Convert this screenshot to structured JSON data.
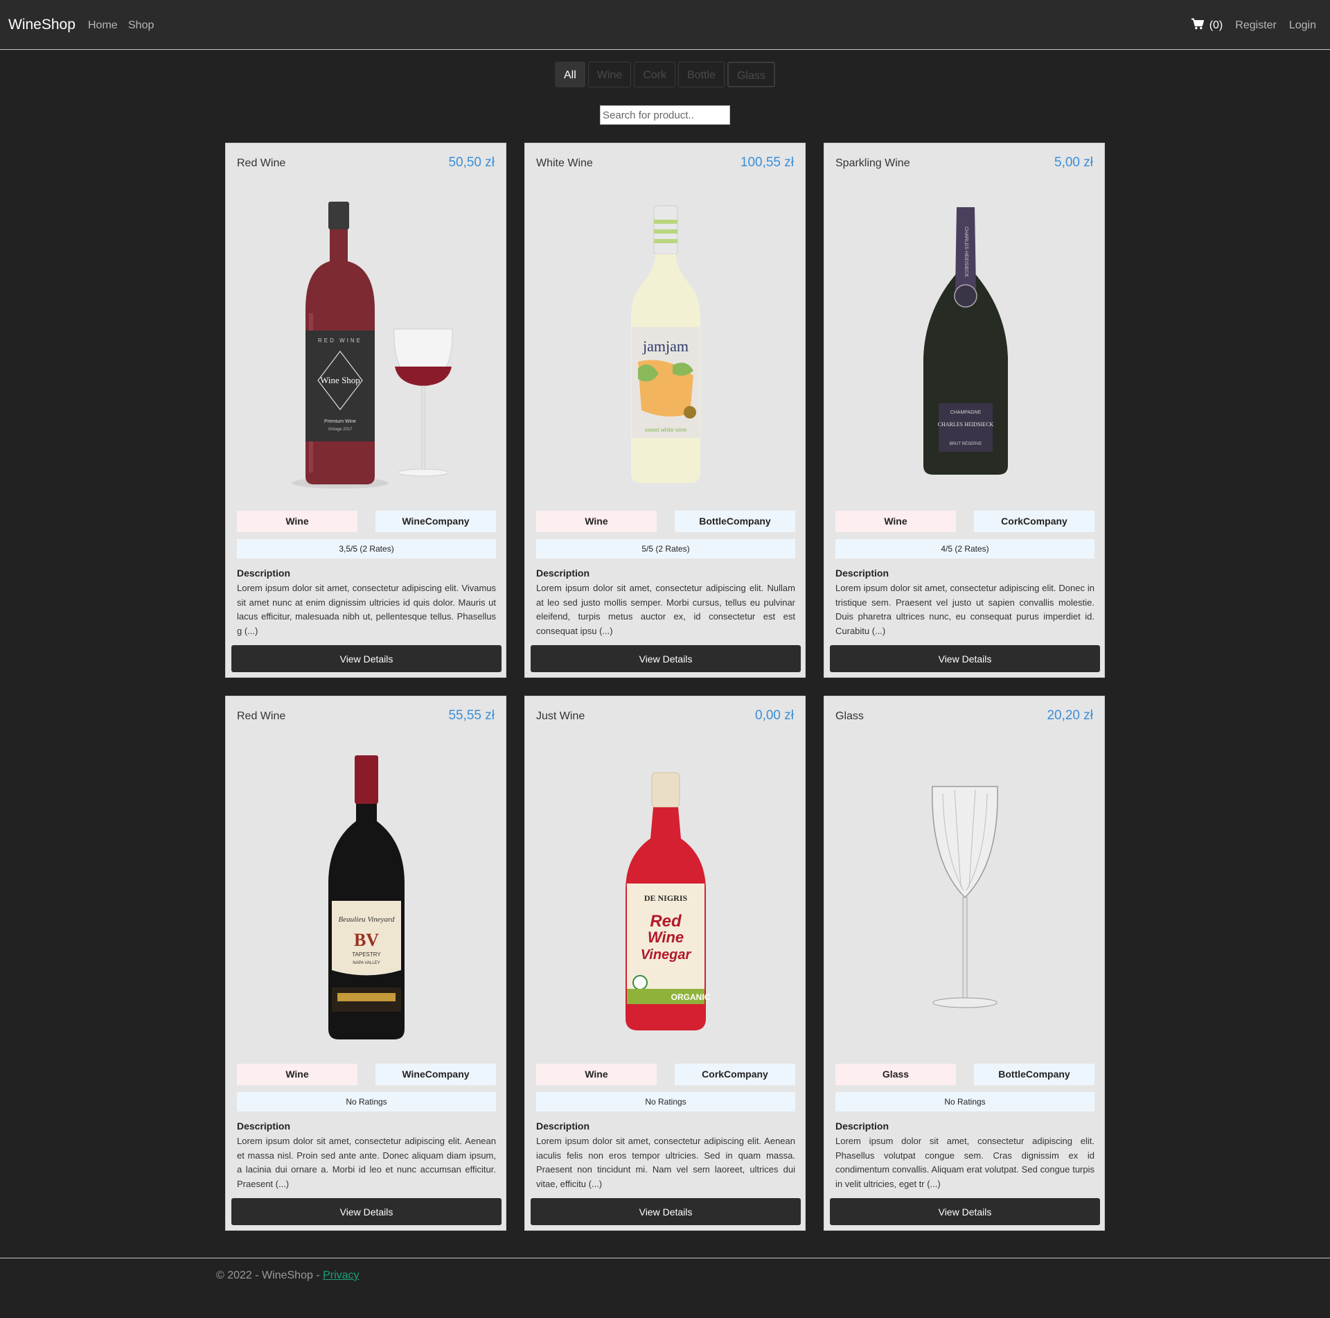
{
  "nav": {
    "brand": "WineShop",
    "home": "Home",
    "shop": "Shop",
    "cart_count": "(0)",
    "register": "Register",
    "login": "Login"
  },
  "filters": [
    "All",
    "Wine",
    "Cork",
    "Bottle",
    "Glass"
  ],
  "active_filter": "All",
  "search": {
    "placeholder": "Search for product.."
  },
  "products": [
    {
      "name": "Red Wine",
      "price": "50,50 zł",
      "category": "Wine",
      "company": "WineCompany",
      "rating": "3,5/5 (2 Rates)",
      "description_label": "Description",
      "description": "Lorem ipsum dolor sit amet, consectetur adipiscing elit. Vivamus sit amet nunc at enim dignissim ultricies id quis dolor. Mauris ut lacus efficitur, malesuada nibh ut, pellentesque tellus. Phasellus g (...)",
      "button": "View Details",
      "label_top": "RED WINE",
      "label_brand": "Wine Shop",
      "label_sub": "Premium Wine",
      "label_vintage": "Vintage 2017"
    },
    {
      "name": "White Wine",
      "price": "100,55 zł",
      "category": "Wine",
      "company": "BottleCompany",
      "rating": "5/5 (2 Rates)",
      "description_label": "Description",
      "description": "Lorem ipsum dolor sit amet, consectetur adipiscing elit. Nullam at leo sed justo mollis semper. Morbi cursus, tellus eu pulvinar eleifend, turpis metus auctor ex, id consectetur est est consequat ipsu (...)",
      "button": "View Details",
      "label_brand": "jamjam",
      "label_sub": "sweet white wine"
    },
    {
      "name": "Sparkling Wine",
      "price": "5,00 zł",
      "category": "Wine",
      "company": "CorkCompany",
      "rating": "4/5 (2 Rates)",
      "description_label": "Description",
      "description": "Lorem ipsum dolor sit amet, consectetur adipiscing elit. Donec in tristique sem. Praesent vel justo ut sapien convallis molestie. Duis pharetra ultrices nunc, eu consequat purus imperdiet id. Curabitu (...)",
      "button": "View Details",
      "label_top": "CHAMPAGNE",
      "label_brand": "CHARLES HEIDSIECK",
      "label_neck": "CHARLES HEIDSIECK",
      "label_sub": "BRUT RÉSERVE"
    },
    {
      "name": "Red Wine",
      "price": "55,55 zł",
      "category": "Wine",
      "company": "WineCompany",
      "rating": "No Ratings",
      "description_label": "Description",
      "description": "Lorem ipsum dolor sit amet, consectetur adipiscing elit. Aenean et massa nisl. Proin sed ante ante. Donec aliquam diam ipsum, a lacinia dui ornare a. Morbi id leo et nunc accumsan efficitur. Praesent (...)",
      "button": "View Details",
      "label_top": "Beaulieu Vineyard",
      "label_brand": "BV",
      "label_sub": "TAPESTRY",
      "label_region": "NAPA VALLEY"
    },
    {
      "name": "Just Wine",
      "price": "0,00 zł",
      "category": "Wine",
      "company": "CorkCompany",
      "rating": "No Ratings",
      "description_label": "Description",
      "description": "Lorem ipsum dolor sit amet, consectetur adipiscing elit. Aenean iaculis felis non eros tempor ultricies. Sed in quam massa. Praesent non tincidunt mi. Nam vel sem laoreet, ultrices dui vitae, efficitu (...)",
      "button": "View Details",
      "label_top": "DE NIGRIS",
      "label_line1": "Red",
      "label_line2": "Wine",
      "label_line3": "Vinegar",
      "label_sub": "ORGANIC"
    },
    {
      "name": "Glass",
      "price": "20,20 zł",
      "category": "Glass",
      "company": "BottleCompany",
      "rating": "No Ratings",
      "description_label": "Description",
      "description": "Lorem ipsum dolor sit amet, consectetur adipiscing elit. Phasellus volutpat congue sem. Cras dignissim ex id condimentum convallis. Aliquam erat volutpat. Sed congue turpis in velit ultricies, eget tr (...)",
      "button": "View Details"
    }
  ],
  "footer": {
    "text": "© 2022 - WineShop - ",
    "privacy": "Privacy"
  },
  "colors": {
    "price": "#3a8fd9",
    "category_tag": "#fdeef0",
    "company_tag": "#eef6fd",
    "privacy_link": "#1aa179"
  }
}
